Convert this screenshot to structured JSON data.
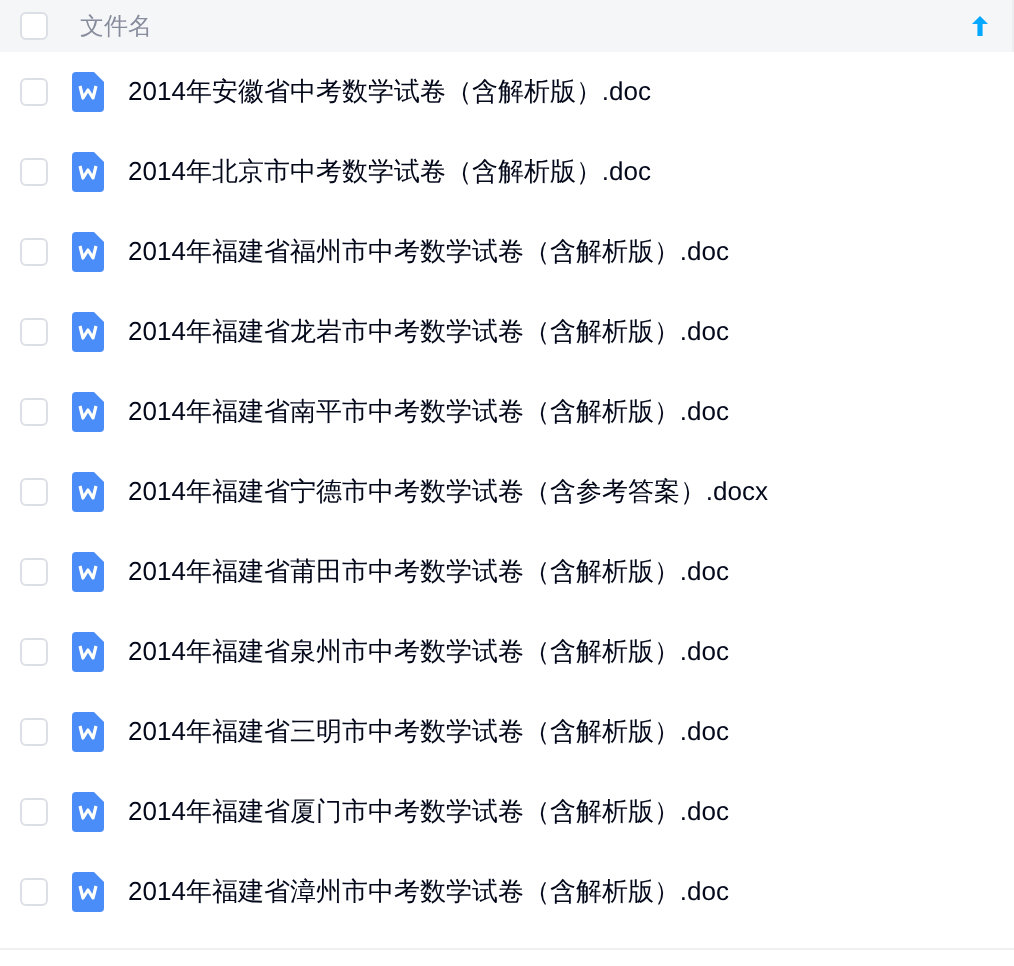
{
  "header": {
    "column_name": "文件名",
    "select_all_checked": false
  },
  "files": [
    {
      "name": "2014年安徽省中考数学试卷（含解析版）.doc",
      "checked": false
    },
    {
      "name": "2014年北京市中考数学试卷（含解析版）.doc",
      "checked": false
    },
    {
      "name": "2014年福建省福州市中考数学试卷（含解析版）.doc",
      "checked": false
    },
    {
      "name": "2014年福建省龙岩市中考数学试卷（含解析版）.doc",
      "checked": false
    },
    {
      "name": "2014年福建省南平市中考数学试卷（含解析版）.doc",
      "checked": false
    },
    {
      "name": "2014年福建省宁德市中考数学试卷（含参考答案）.docx",
      "checked": false
    },
    {
      "name": "2014年福建省莆田市中考数学试卷（含解析版）.doc",
      "checked": false
    },
    {
      "name": "2014年福建省泉州市中考数学试卷（含解析版）.doc",
      "checked": false
    },
    {
      "name": "2014年福建省三明市中考数学试卷（含解析版）.doc",
      "checked": false
    },
    {
      "name": "2014年福建省厦门市中考数学试卷（含解析版）.doc",
      "checked": false
    },
    {
      "name": "2014年福建省漳州市中考数学试卷（含解析版）.doc",
      "checked": false
    }
  ]
}
